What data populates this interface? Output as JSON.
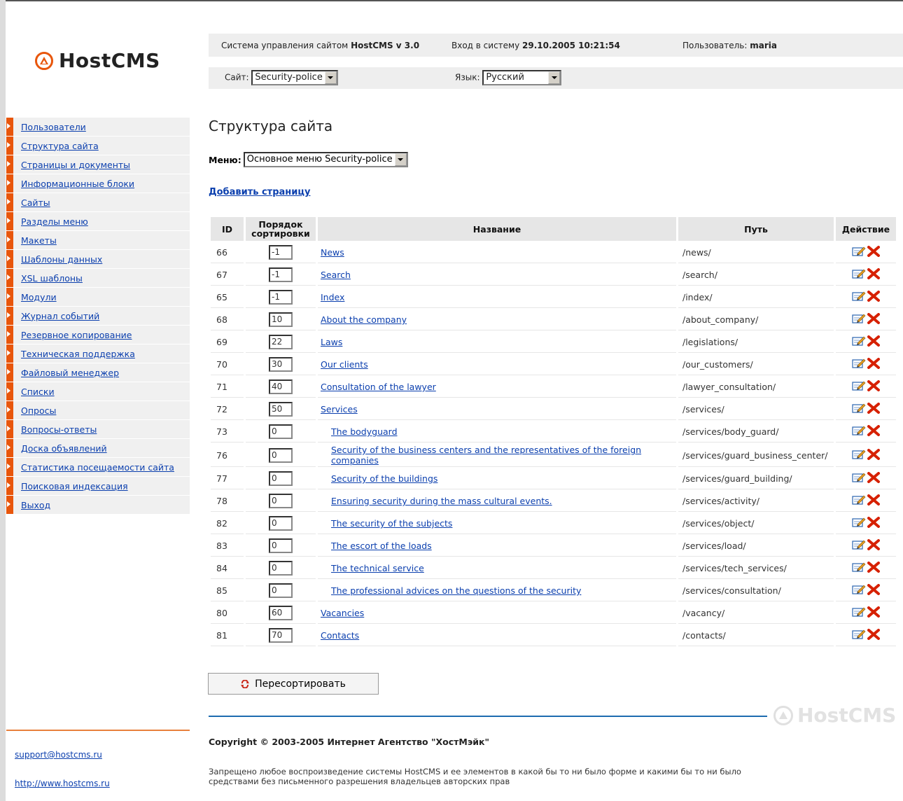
{
  "logo": {
    "text": "HostCMS"
  },
  "header": {
    "system_label": "Система управления сайтом",
    "system_name": "HostCMS v 3.0",
    "login_label": "Вход в систему",
    "login_time": "29.10.2005 10:21:54",
    "user_label": "Пользователь:",
    "user_name": "maria",
    "site_label": "Сайт:",
    "site_value": "Security-police",
    "lang_label": "Язык:",
    "lang_value": "Русский"
  },
  "sidebar": {
    "items": [
      {
        "label": "Пользователи"
      },
      {
        "label": "Структура сайта"
      },
      {
        "label": "Страницы и документы"
      },
      {
        "label": "Информационные блоки"
      },
      {
        "label": "Сайты"
      },
      {
        "label": "Разделы меню"
      },
      {
        "label": "Макеты"
      },
      {
        "label": "Шаблоны данных"
      },
      {
        "label": "XSL шаблоны"
      },
      {
        "label": "Модули"
      },
      {
        "label": "Журнал событий"
      },
      {
        "label": "Резервное копирование"
      },
      {
        "label": "Техническая поддержка"
      },
      {
        "label": "Файловый менеджер"
      },
      {
        "label": "Списки"
      },
      {
        "label": "Опросы"
      },
      {
        "label": "Вопросы-ответы"
      },
      {
        "label": "Доска объявлений"
      },
      {
        "label": "Статистика посещаемости сайта"
      },
      {
        "label": "Поисковая индексация"
      },
      {
        "label": "Выход"
      }
    ],
    "support_email": "support@hostcms.ru",
    "site_url": "http://www.hostcms.ru"
  },
  "main": {
    "title": "Структура сайта",
    "menu_label": "Меню:",
    "menu_value": "Основное меню Security-police",
    "add_page": "Добавить страницу",
    "columns": {
      "id": "ID",
      "order_line1": "Порядок",
      "order_line2": "сортировки",
      "name": "Название",
      "path": "Путь",
      "action": "Действие"
    },
    "rows": [
      {
        "id": "66",
        "order": "-1",
        "name": "News",
        "path": "/news/",
        "child": false
      },
      {
        "id": "67",
        "order": "-1",
        "name": "Search",
        "path": "/search/",
        "child": false
      },
      {
        "id": "65",
        "order": "-1",
        "name": "Index",
        "path": "/index/",
        "child": false
      },
      {
        "id": "68",
        "order": "10",
        "name": "About the company",
        "path": "/about_company/",
        "child": false
      },
      {
        "id": "69",
        "order": "22",
        "name": "Laws",
        "path": "/legislations/",
        "child": false
      },
      {
        "id": "70",
        "order": "30",
        "name": "Our clients",
        "path": "/our_customers/",
        "child": false
      },
      {
        "id": "71",
        "order": "40",
        "name": "Consultation of the lawyer",
        "path": "/lawyer_consultation/",
        "child": false
      },
      {
        "id": "72",
        "order": "50",
        "name": "Services",
        "path": "/services/",
        "child": false
      },
      {
        "id": "73",
        "order": "0",
        "name": "The bodyguard",
        "path": "/services/body_guard/",
        "child": true
      },
      {
        "id": "76",
        "order": "0",
        "name": "Security of the business centers and the representatives of the foreign companies",
        "path": "/services/guard_business_center/",
        "child": true
      },
      {
        "id": "77",
        "order": "0",
        "name": "Security of the buildings",
        "path": "/services/guard_building/",
        "child": true
      },
      {
        "id": "78",
        "order": "0",
        "name": "Ensuring security during the mass cultural events.",
        "path": "/services/activity/",
        "child": true
      },
      {
        "id": "82",
        "order": "0",
        "name": "The security of the subjects",
        "path": "/services/object/",
        "child": true
      },
      {
        "id": "83",
        "order": "0",
        "name": "The escort of the loads",
        "path": "/services/load/",
        "child": true
      },
      {
        "id": "84",
        "order": "0",
        "name": "The technical service",
        "path": "/services/tech_services/",
        "child": true
      },
      {
        "id": "85",
        "order": "0",
        "name": "The professional advices on the questions of the security",
        "path": "/services/consultation/",
        "child": true
      },
      {
        "id": "80",
        "order": "60",
        "name": "Vacancies",
        "path": "/vacancy/",
        "child": false
      },
      {
        "id": "81",
        "order": "70",
        "name": "Contacts",
        "path": "/contacts/",
        "child": false
      }
    ],
    "resort_button": "Пересортировать"
  },
  "footer": {
    "watermark": "HostCMS",
    "copyright": "Copyright © 2003-2005 Интернет Агентство \"ХостМэйк\"",
    "disclaimer": "Запрещено любое воспроизведение системы HostCMS и ее элементов в какой бы то ни было форме и какими бы то ни было средствами без письменного разрешения владельцев авторских прав"
  },
  "colors": {
    "accent": "#e8560c",
    "link": "#0b3fae",
    "divider": "#1d6bb0",
    "delete": "#d62000"
  }
}
